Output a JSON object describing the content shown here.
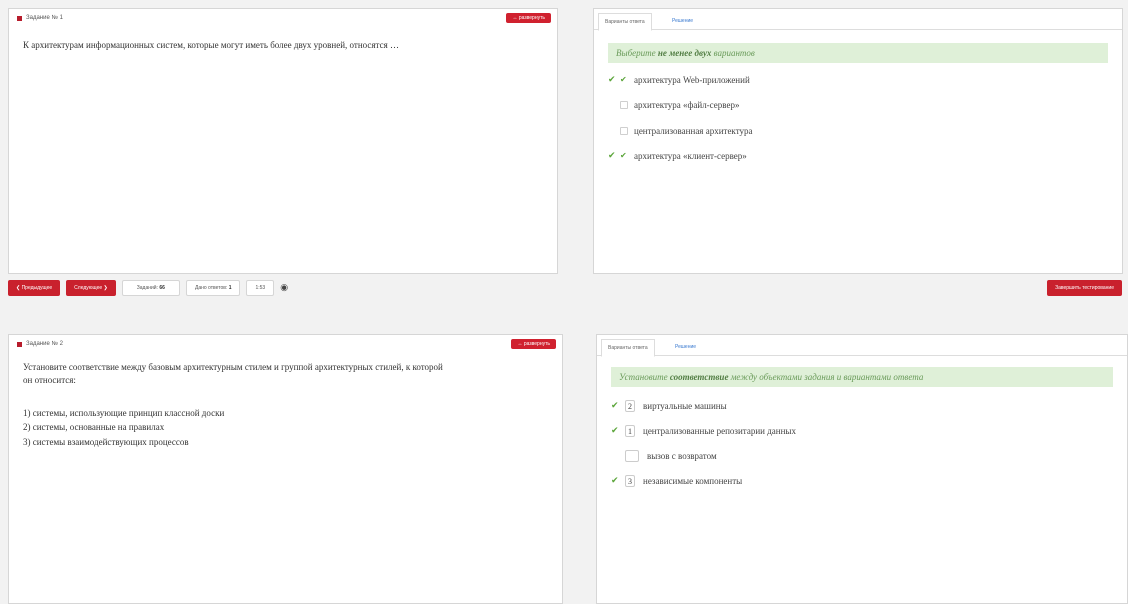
{
  "task1": {
    "header": "Задание № 1",
    "expand_label": "↔ развернуть",
    "question": "К архитектурам информационных систем, которые могут иметь более двух уровней, относятся …",
    "tabs": [
      "Варианты ответа",
      "Решение"
    ],
    "hint_pre": "Выберите ",
    "hint_bold": "не менее двух",
    "hint_post": " вариантов",
    "options": [
      {
        "label": "архитектура Web-приложений",
        "checked": true,
        "correct": true
      },
      {
        "label": "архитектура «файл-сервер»",
        "checked": false,
        "correct": false
      },
      {
        "label": "централизованная архитектура",
        "checked": false,
        "correct": false
      },
      {
        "label": "архитектура «клиент-сервер»",
        "checked": true,
        "correct": true
      }
    ]
  },
  "navbar": {
    "prev_label": "❮ Предыдущее",
    "next_label": "Следующее ❯",
    "tasks_label": "Заданий:",
    "tasks_count": "66",
    "answers_label": "Дано ответов:",
    "answers_count": "1",
    "timer": "1:53",
    "finish_label": "Завершить тестирование"
  },
  "task2": {
    "header": "Задание № 2",
    "expand_label": "↔ развернуть",
    "question_line1": "Установите соответствие между базовым архитектурным стилем и группой архитектурных стилей, к которой",
    "question_line2": "он относится:",
    "items": [
      "1) системы, использующие принцип классной доски",
      "2) системы, основанные на правилах",
      "3) системы взаимодействующих процессов"
    ],
    "tabs": [
      "Варианты ответа",
      "Решение"
    ],
    "hint_pre": "Установите ",
    "hint_bold": "соответствие",
    "hint_post": " между объектами задания и вариантами ответа",
    "options": [
      {
        "num": "2",
        "label": "виртуальные машины",
        "correct": true
      },
      {
        "num": "1",
        "label": "централизованные репозитарии данных",
        "correct": true
      },
      {
        "num": "",
        "label": "вызов с возвратом",
        "correct": false
      },
      {
        "num": "3",
        "label": "независимые компоненты",
        "correct": true
      }
    ]
  },
  "colors": {
    "accent_red": "#c9212d",
    "hint_green_bg": "#dff0d8",
    "check_green": "#5ba53a"
  }
}
